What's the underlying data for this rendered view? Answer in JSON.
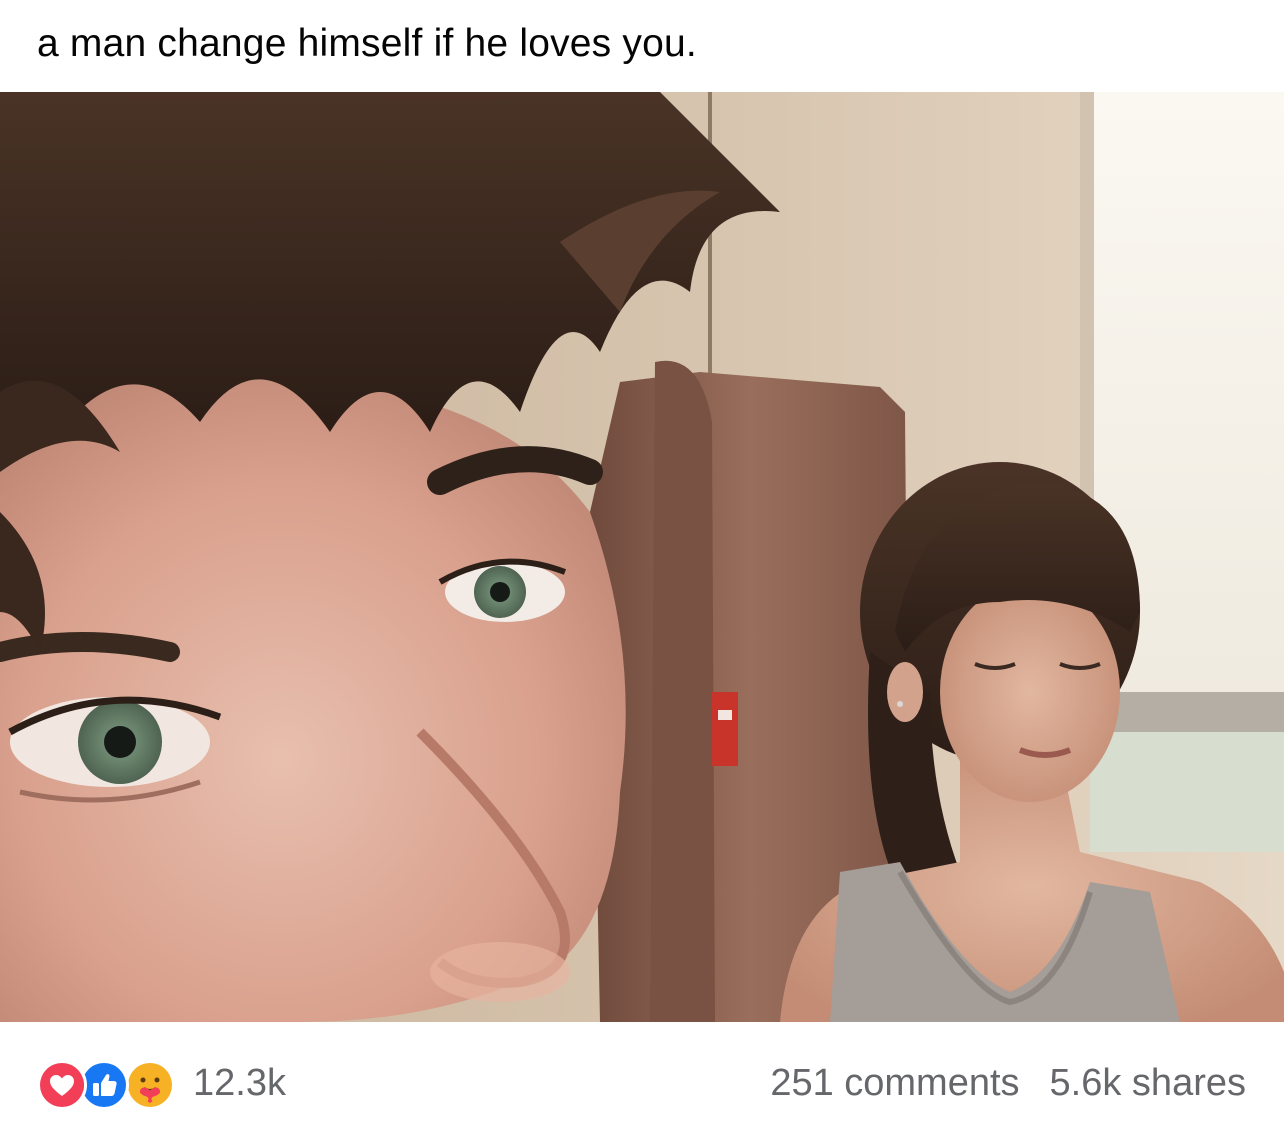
{
  "post": {
    "caption": "a man change himself if he loves you.",
    "photo": {
      "icon": "selfie-photo"
    }
  },
  "footer": {
    "reactions": {
      "icons": [
        "love-reaction-icon",
        "like-reaction-icon",
        "care-reaction-icon"
      ],
      "count": "12.3k"
    },
    "comments": "251 comments",
    "shares": "5.6k shares"
  },
  "colors": {
    "text_primary": "#050505",
    "text_secondary": "#65676b",
    "love": "#f33e58",
    "like": "#1877f2",
    "care": "#f7b125"
  }
}
